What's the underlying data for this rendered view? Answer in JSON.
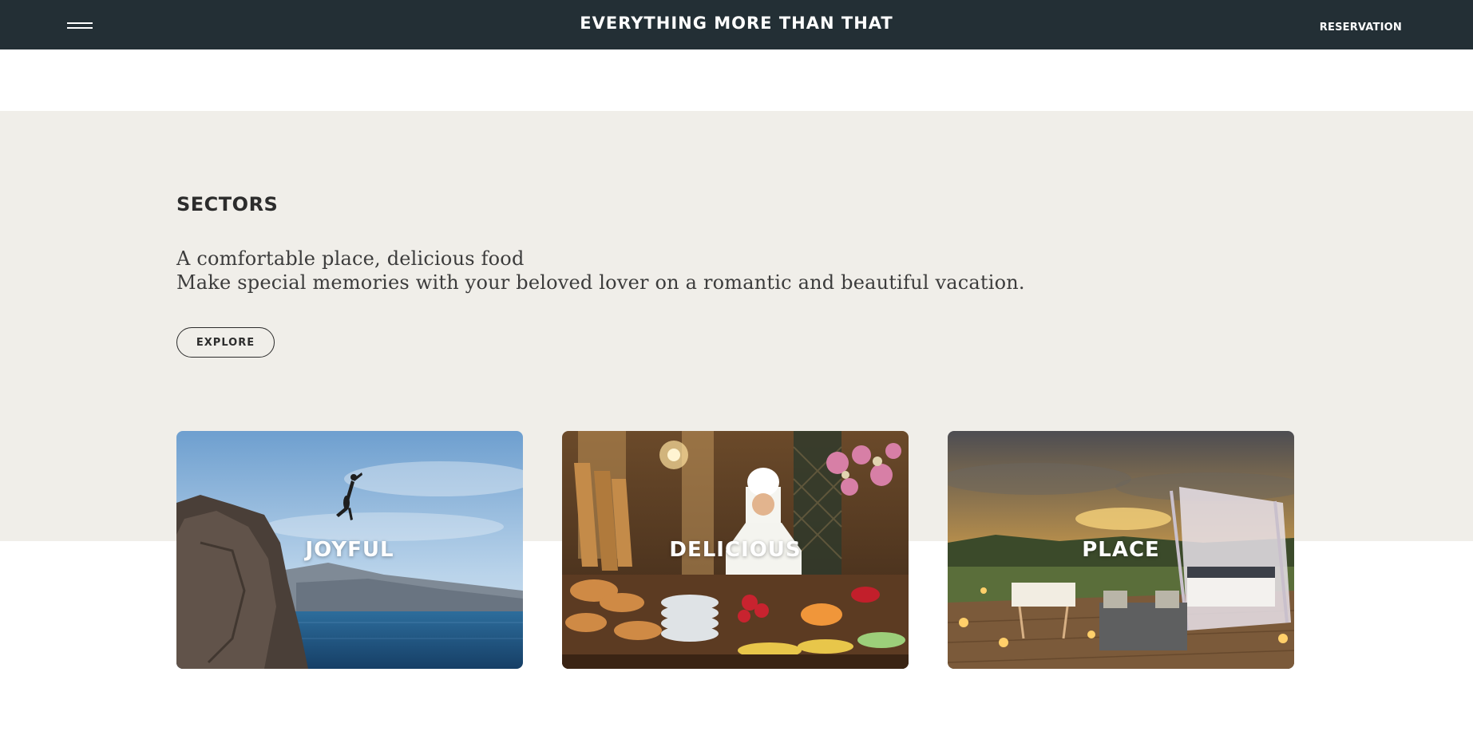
{
  "header": {
    "title": "EVERYTHING MORE THAN THAT",
    "menu_icon": "hamburger-menu-icon",
    "reservation_label": "RESERVATION",
    "background_color": "#232f35"
  },
  "sectors": {
    "heading": "SECTORS",
    "description_line_1": "A comfortable place, delicious food",
    "description_line_2": "Make special memories with your beloved lover on a romantic and beautiful vacation.",
    "explore_label": "EXPLORE",
    "background_color": "#f0eee9"
  },
  "cards": [
    {
      "label": "JOYFUL"
    },
    {
      "label": "DELICIOUS"
    },
    {
      "label": "PLACE"
    }
  ]
}
